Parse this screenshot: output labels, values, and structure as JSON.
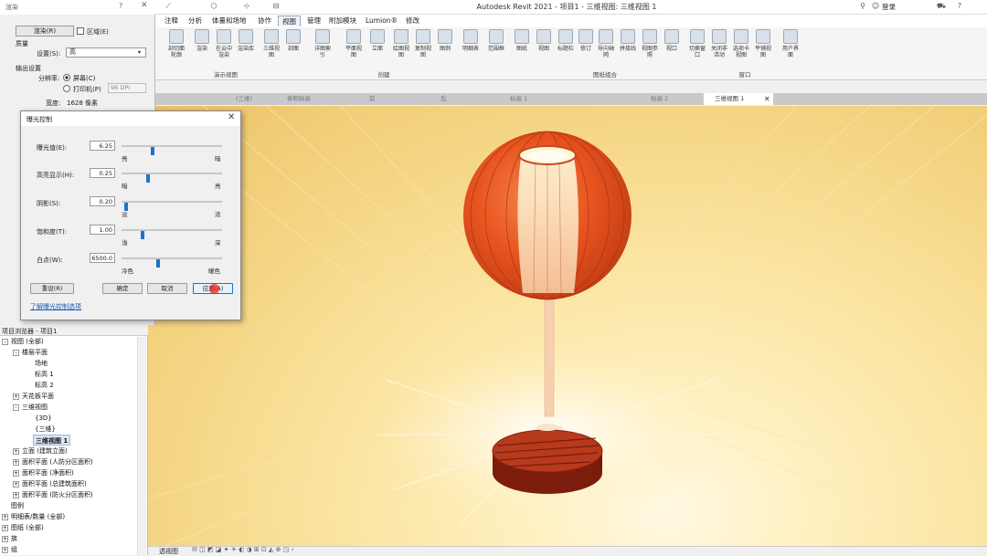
{
  "window": {
    "title": "Autodesk Revit 2021 - 项目1 - 三维视图: 三维视图 1",
    "login": "登录"
  },
  "ribbon": {
    "tabs": [
      "注释",
      "分析",
      "体量和场地",
      "协作",
      "视图",
      "管理",
      "附加模块",
      "Lumion®",
      "修改"
    ],
    "active_tab": "视图",
    "buttons": [
      "剖切面轮廓",
      "渲染",
      "在云中渲染",
      "渲染库",
      "三维视图",
      "剖面",
      "详图索引",
      "平面视图",
      "立面",
      "绘图视图",
      "复制视图",
      "图例",
      "明细表",
      "范围框",
      "图纸",
      "视图",
      "标题栏",
      "修订",
      "导向轴网",
      "拼接线",
      "视图参照",
      "视口",
      "切换窗口",
      "关闭非活动",
      "选项卡视图",
      "平铺视图",
      "用户界面"
    ],
    "groups": [
      "演示视图",
      "创建",
      "图纸组合",
      "窗口"
    ]
  },
  "view_tabs": [
    "(三维)",
    "参照标高",
    "前",
    "后",
    "标高 1",
    "标高 2",
    "三维视图 1"
  ],
  "render_dialog": {
    "title": "渲染",
    "render_button": "渲染(R)",
    "region_label": "区域(E)",
    "quality_label": "质量",
    "setting_label": "设置(S):",
    "setting_value": "高",
    "output_label": "输出设置",
    "resolution_label": "分辨率:",
    "screen_option": "屏幕(C)",
    "printer_option": "打印机(P)",
    "dpi_value": "96 DPI",
    "width_label": "宽度:",
    "width_value": "1628 像素"
  },
  "exposure_dialog": {
    "title": "曝光控制",
    "sliders": [
      {
        "label": "曝光值(E):",
        "value": "6.25",
        "min": "亮",
        "max": "暗",
        "pos": 0.3
      },
      {
        "label": "高亮显示(H):",
        "value": "0.25",
        "min": "暗",
        "max": "亮",
        "pos": 0.25
      },
      {
        "label": "阴影(S):",
        "value": "0.20",
        "min": "淡",
        "max": "浓",
        "pos": 0.03
      },
      {
        "label": "饱和度(T):",
        "value": "1.00",
        "min": "浅",
        "max": "深",
        "pos": 0.2
      },
      {
        "label": "白点(W):",
        "value": "6500.0",
        "min": "冷色",
        "max": "暖色",
        "pos": 0.36
      }
    ],
    "reset_button": "重设(R)",
    "ok_button": "确定",
    "cancel_button": "取消",
    "apply_button": "应用(A)",
    "help_link": "了解曝光控制选项"
  },
  "project_browser": {
    "title": "项目浏览器 - 项目1",
    "items": [
      {
        "label": "视图 (全部)",
        "level": 0,
        "expander": "-"
      },
      {
        "label": "楼层平面",
        "level": 1,
        "expander": "-"
      },
      {
        "label": "场地",
        "level": 2,
        "expander": ""
      },
      {
        "label": "标高 1",
        "level": 2,
        "expander": ""
      },
      {
        "label": "标高 2",
        "level": 2,
        "expander": ""
      },
      {
        "label": "天花板平面",
        "level": 1,
        "expander": "+"
      },
      {
        "label": "三维视图",
        "level": 1,
        "expander": "-"
      },
      {
        "label": "{3D}",
        "level": 2,
        "expander": ""
      },
      {
        "label": "{三维}",
        "level": 2,
        "expander": ""
      },
      {
        "label": "三维视图 1",
        "level": 2,
        "expander": ""
      },
      {
        "label": "立面 (建筑立面)",
        "level": 1,
        "expander": "+"
      },
      {
        "label": "面积平面 (人防分区面积)",
        "level": 1,
        "expander": "+"
      },
      {
        "label": "面积平面 (净面积)",
        "level": 1,
        "expander": "+"
      },
      {
        "label": "面积平面 (总建筑面积)",
        "level": 1,
        "expander": "+"
      },
      {
        "label": "面积平面 (防火分区面积)",
        "level": 1,
        "expander": "+"
      },
      {
        "label": "图例",
        "level": 0,
        "expander": ""
      },
      {
        "label": "明细表/数量 (全部)",
        "level": 0,
        "expander": "+"
      },
      {
        "label": "图纸 (全部)",
        "level": 0,
        "expander": "+"
      },
      {
        "label": "族",
        "level": 0,
        "expander": "+"
      },
      {
        "label": "组",
        "level": 0,
        "expander": "+"
      }
    ]
  },
  "status": {
    "view_label": "透视图"
  },
  "colors": {
    "accent": "#1e73c8",
    "lamp": "#e8501f",
    "wall": "#f7dc95"
  }
}
